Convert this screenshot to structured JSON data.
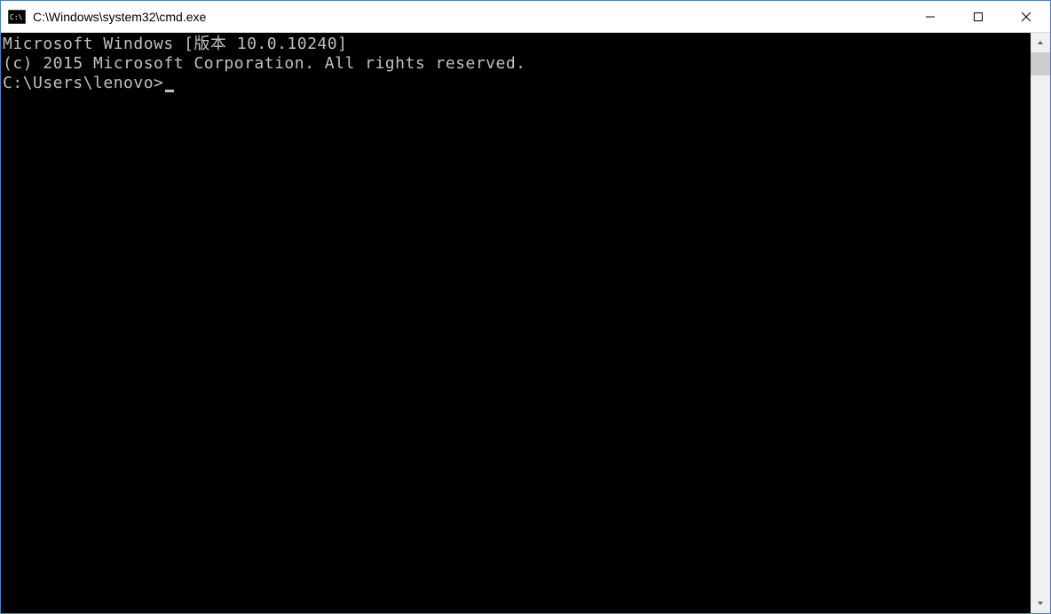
{
  "window": {
    "title": "C:\\Windows\\system32\\cmd.exe"
  },
  "console": {
    "line1": "Microsoft Windows [版本 10.0.10240]",
    "line2": "(c) 2015 Microsoft Corporation. All rights reserved.",
    "blank": "",
    "prompt": "C:\\Users\\lenovo>"
  }
}
